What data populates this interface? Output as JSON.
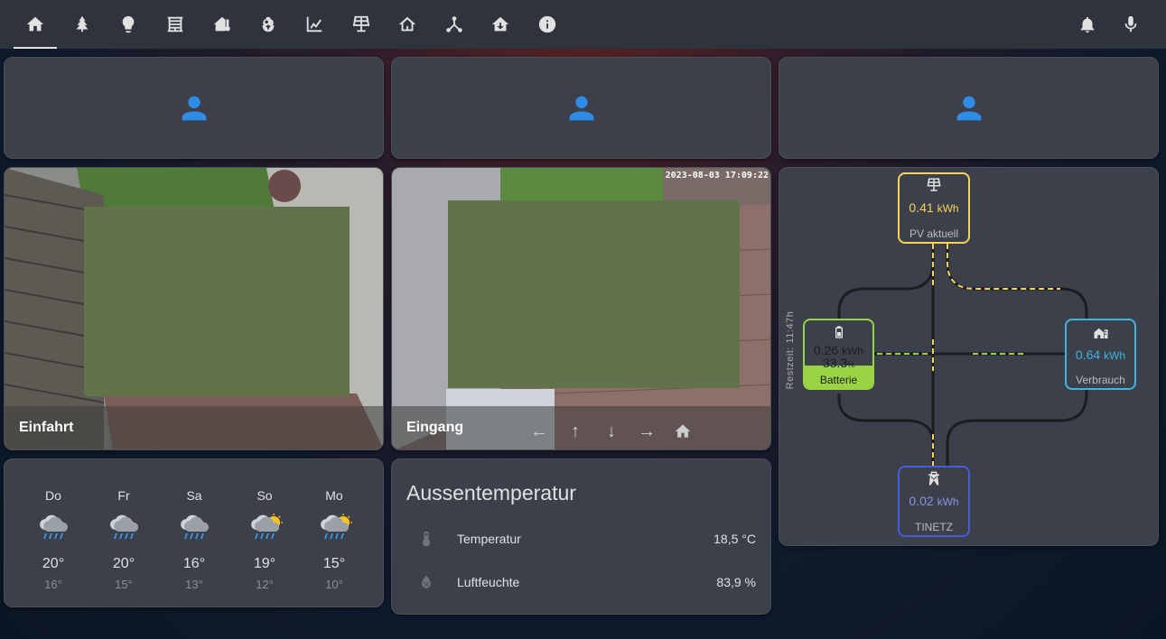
{
  "nav": {
    "tabs": [
      {
        "icon": "home-icon",
        "active": true
      },
      {
        "icon": "tree-icon",
        "active": false
      },
      {
        "icon": "lightbulb-icon",
        "active": false
      },
      {
        "icon": "blinds-icon",
        "active": false
      },
      {
        "icon": "home-thermometer-icon",
        "active": false
      },
      {
        "icon": "flower-icon",
        "active": false
      },
      {
        "icon": "chart-line-icon",
        "active": false
      },
      {
        "icon": "solar-panel-icon",
        "active": false
      },
      {
        "icon": "home-outline-icon",
        "active": false
      },
      {
        "icon": "network-icon",
        "active": false
      },
      {
        "icon": "home-import-icon",
        "active": false
      },
      {
        "icon": "information-icon",
        "active": false
      }
    ],
    "right": [
      {
        "icon": "bell-icon"
      },
      {
        "icon": "microphone-icon"
      }
    ]
  },
  "persons": [
    {
      "icon": "account-icon"
    },
    {
      "icon": "account-icon"
    },
    {
      "icon": "account-icon"
    }
  ],
  "cameras": {
    "einfahrt": {
      "caption": "Einfahrt"
    },
    "eingang": {
      "caption": "Eingang",
      "timestamp": "2023-08-03 17:09:22"
    }
  },
  "weather": {
    "days": [
      {
        "name": "Do",
        "hi": "20°",
        "lo": "16°",
        "condition": "rainy-icon"
      },
      {
        "name": "Fr",
        "hi": "20°",
        "lo": "15°",
        "condition": "rainy-icon"
      },
      {
        "name": "Sa",
        "hi": "16°",
        "lo": "13°",
        "condition": "rainy-icon"
      },
      {
        "name": "So",
        "hi": "19°",
        "lo": "12°",
        "condition": "partly-rainy-sun-icon"
      },
      {
        "name": "Mo",
        "hi": "15°",
        "lo": "10°",
        "condition": "partly-rainy-sun-icon"
      }
    ]
  },
  "outside": {
    "title": "Aussentemperatur",
    "rows": [
      {
        "name": "Temperatur",
        "value": "18,5 °C",
        "icon": "thermometer-icon"
      },
      {
        "name": "Luftfeuchte",
        "value": "83,9 %",
        "icon": "water-percent-icon"
      }
    ]
  },
  "energy": {
    "pv": {
      "value": "0.41",
      "unit": "kWh",
      "label": "PV aktuell",
      "color": "#f9d25b"
    },
    "battery": {
      "value": "0.26",
      "unit": "kWh",
      "percent": "33.3",
      "percent_unit": "%",
      "label": "Batterie",
      "color": "#9ad444",
      "level": 0.333
    },
    "home": {
      "value": "0.64",
      "unit": "kWh",
      "label": "Verbrauch",
      "color": "#3fb4e0"
    },
    "grid": {
      "value": "0.02",
      "unit": "kWh",
      "label": "TINETZ",
      "color": "#8c8fdf"
    },
    "remaining": "Restzeit: 11:47h"
  }
}
